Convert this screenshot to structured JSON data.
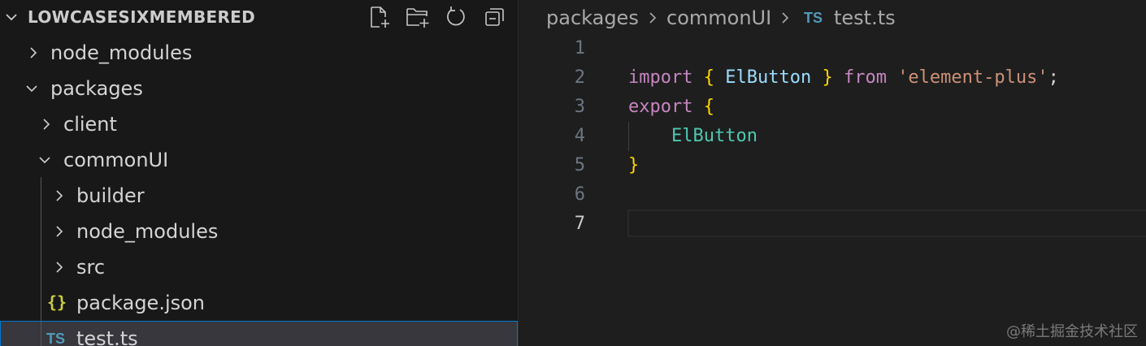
{
  "explorer": {
    "project_name": "LOWCASESIXMEMBERED",
    "header_icons": [
      "new-file-icon",
      "new-folder-icon",
      "refresh-icon",
      "collapse-all-icon"
    ],
    "items": [
      {
        "label": "node_modules",
        "type": "folder",
        "expanded": false
      },
      {
        "label": "packages",
        "type": "folder",
        "expanded": true
      },
      {
        "label": "client",
        "type": "folder",
        "expanded": false
      },
      {
        "label": "commonUI",
        "type": "folder",
        "expanded": true
      },
      {
        "label": "builder",
        "type": "folder",
        "expanded": false
      },
      {
        "label": "node_modules",
        "type": "folder",
        "expanded": false
      },
      {
        "label": "src",
        "type": "folder",
        "expanded": false
      },
      {
        "label": "package.json",
        "type": "file",
        "icon_text": "{}"
      },
      {
        "label": "test.ts",
        "type": "file",
        "icon_text": "TS",
        "selected": true
      }
    ]
  },
  "editor": {
    "breadcrumb": {
      "parts": [
        "packages",
        "commonUI"
      ],
      "file_icon": "TS",
      "file": "test.ts"
    },
    "line_numbers": [
      "1",
      "2",
      "3",
      "4",
      "5",
      "6",
      "7"
    ],
    "active_line": "7",
    "code": {
      "l2_kw_import": "import",
      "l2_brace_open": "{",
      "l2_ident": "ElButton",
      "l2_brace_close": "}",
      "l2_kw_from": "from",
      "l2_string": "'element-plus'",
      "l2_semi": ";",
      "l3_kw_export": "export",
      "l3_brace_open": "{",
      "l4_ident": "ElButton",
      "l5_brace_close": "}"
    }
  },
  "watermark": "@稀土掘金技术社区",
  "colors": {
    "sidebar_bg": "#181818",
    "editor_bg": "#1e1e1e",
    "selection_border": "#0078d4",
    "ts_icon": "#519aba",
    "json_icon": "#cbcb41",
    "keyword": "#c586c0",
    "brace": "#ffd700",
    "identifier": "#9cdcfe",
    "string": "#ce9178"
  }
}
